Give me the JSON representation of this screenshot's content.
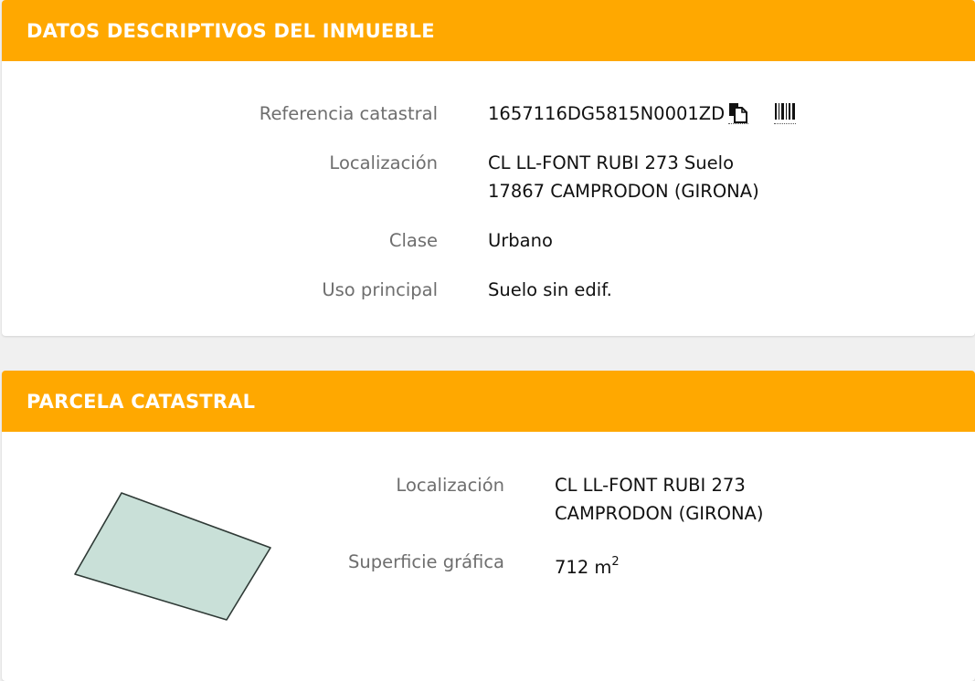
{
  "datos": {
    "title": "DATOS DESCRIPTIVOS DEL INMUEBLE",
    "fields": {
      "ref_label": "Referencia catastral",
      "ref_value": "1657116DG5815N0001ZD",
      "loc_label": "Localización",
      "loc_line1": "CL LL-FONT RUBI 273 Suelo",
      "loc_line2": "17867 CAMPRODON (GIRONA)",
      "clase_label": "Clase",
      "clase_value": "Urbano",
      "uso_label": "Uso principal",
      "uso_value": "Suelo sin edif."
    },
    "icons": {
      "copy": "copy-icon",
      "barcode": "barcode-icon"
    }
  },
  "parcela": {
    "title": "PARCELA CATASTRAL",
    "fields": {
      "loc_label": "Localización",
      "loc_line1": "CL LL-FONT RUBI 273",
      "loc_line2": "CAMPRODON (GIRONA)",
      "sup_label": "Superficie gráfica",
      "sup_value": "712 m",
      "sup_unit_exp": "2"
    },
    "plot_fill": "#c9e0d8"
  },
  "colors": {
    "header_bg": "#ffa800",
    "header_text": "#ffffff"
  }
}
